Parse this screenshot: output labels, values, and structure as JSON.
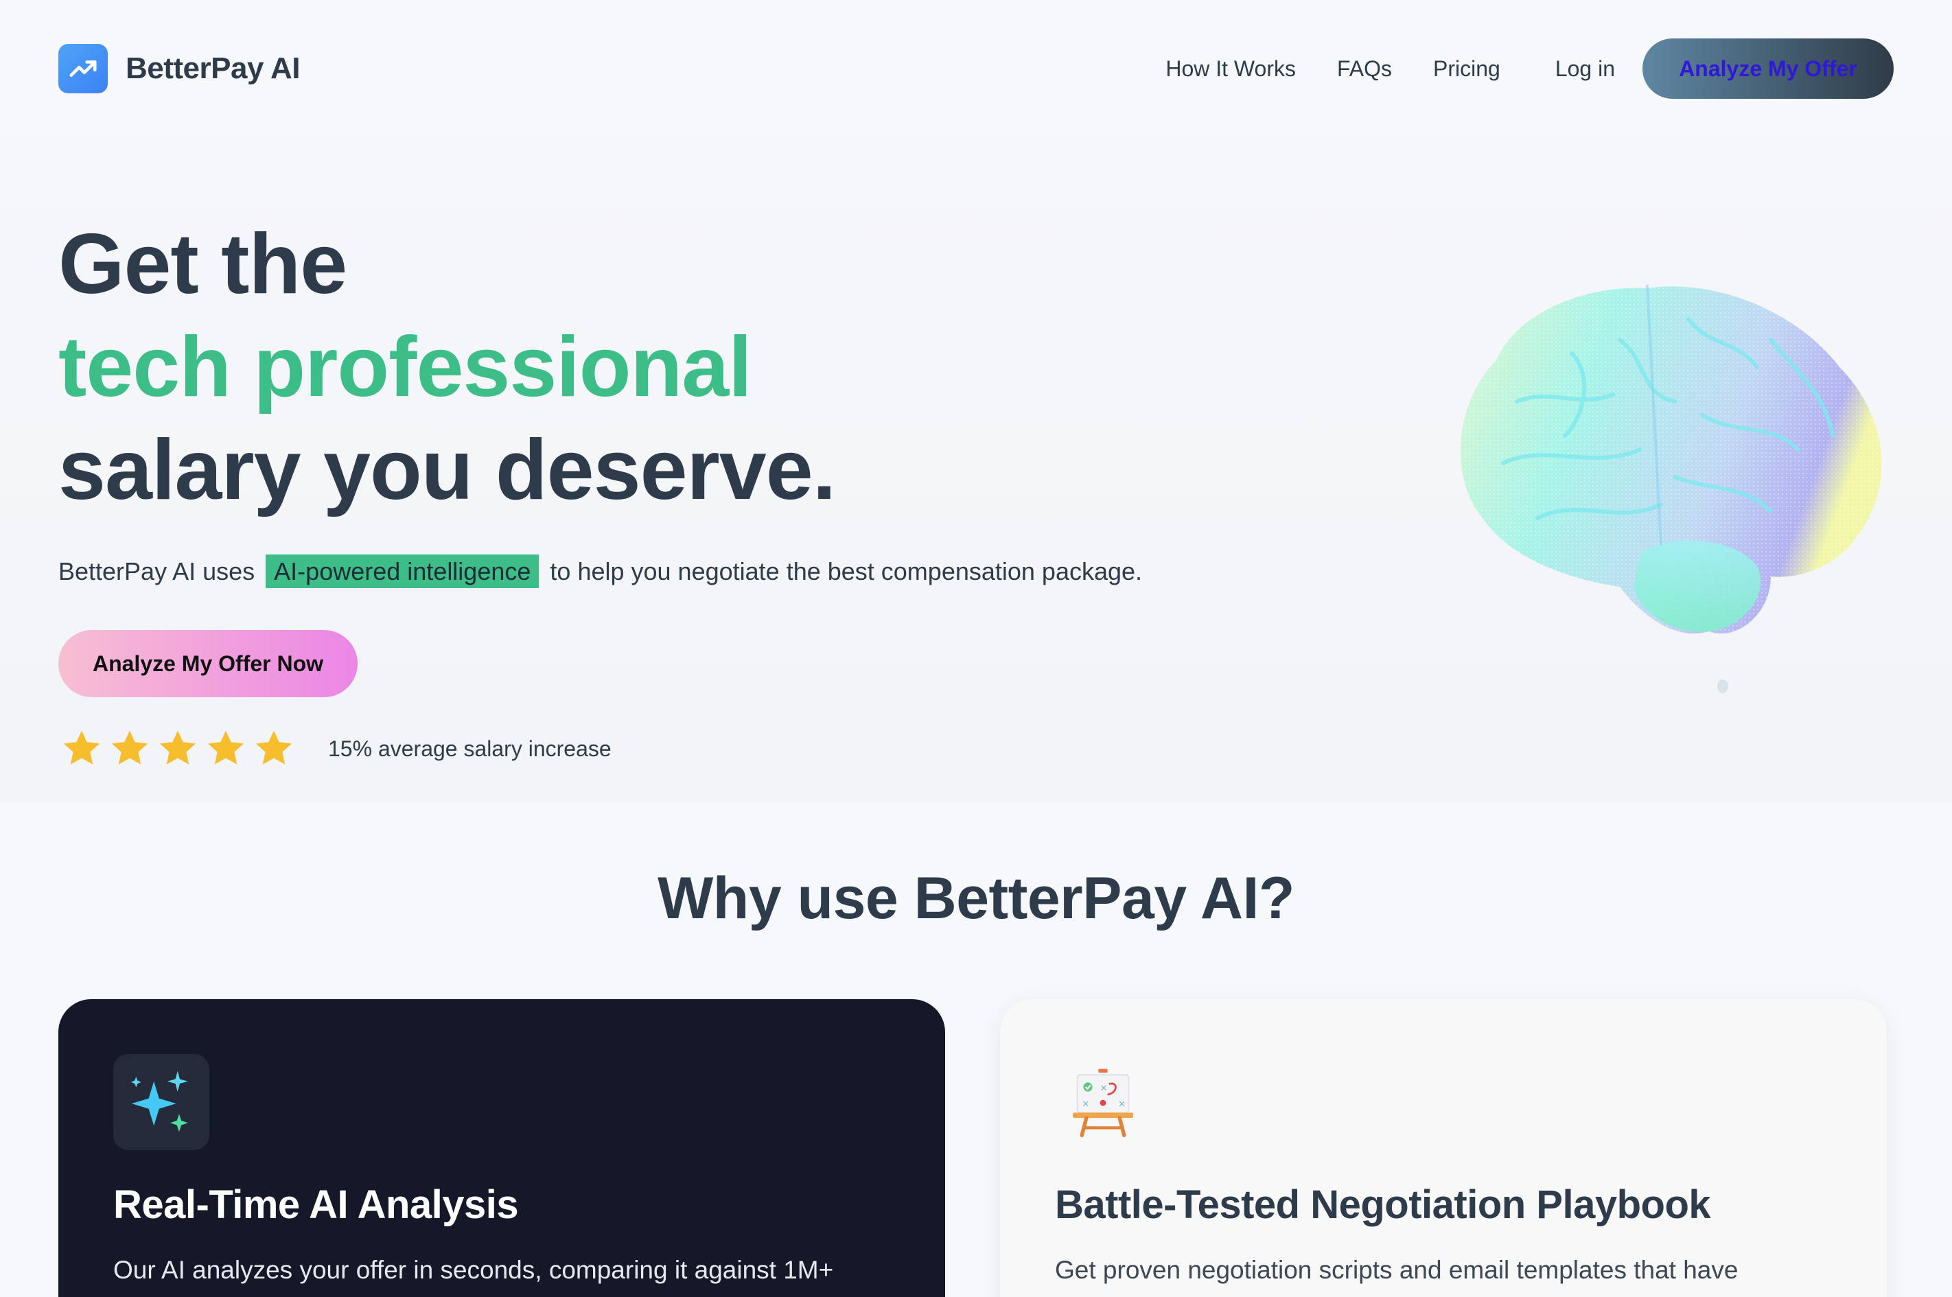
{
  "brand": {
    "name": "BetterPay AI",
    "logo_icon": "trending-up-icon"
  },
  "nav": {
    "links": [
      "How It Works",
      "FAQs",
      "Pricing"
    ],
    "login": "Log in",
    "cta": "Analyze My Offer"
  },
  "hero": {
    "headline_line1": "Get the",
    "headline_accent": "tech professional",
    "headline_line3": "salary you deserve.",
    "sub_before": "BetterPay AI uses",
    "sub_highlight": "AI-powered intelligence",
    "sub_after": "to help you negotiate the best compensation package.",
    "cta": "Analyze My Offer Now",
    "rating_stars": 5,
    "rating_text": "15% average salary increase",
    "illustration": "brain-illustration"
  },
  "why": {
    "title": "Why use BetterPay AI?",
    "cards": [
      {
        "icon": "sparkles-icon",
        "title": "Real-Time AI Analysis",
        "text": "Our AI analyzes your offer in seconds, comparing it against 1M+"
      },
      {
        "icon": "strategy-board-icon",
        "title": "Battle-Tested Negotiation Playbook",
        "text": "Get proven negotiation scripts and email templates that have"
      }
    ]
  },
  "colors": {
    "accent_green": "#3dbd87",
    "text_dark": "#2d3b4a",
    "card_dark": "#141829",
    "star": "#f6bd2d"
  }
}
